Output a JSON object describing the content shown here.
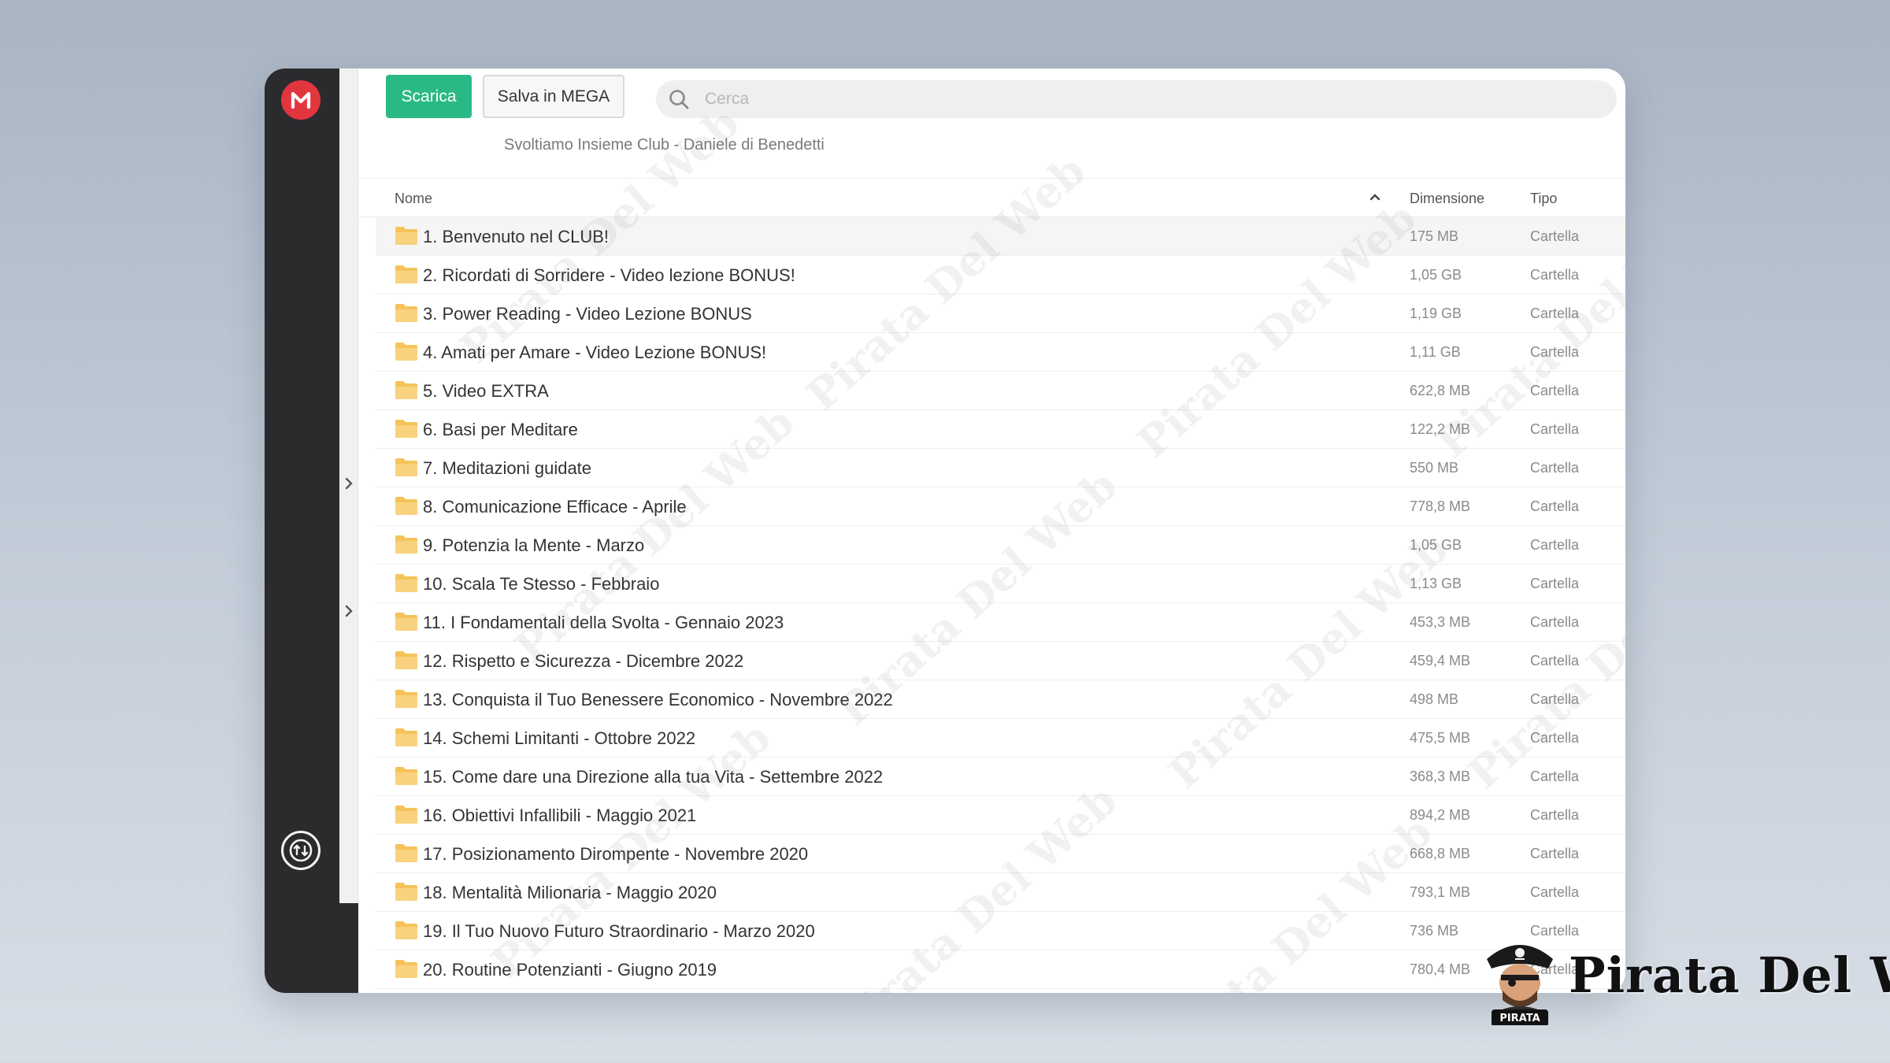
{
  "app": {
    "logo_letter": "M",
    "accent_color": "#e2363f",
    "primary_color": "#2ab985"
  },
  "toolbar": {
    "download_label": "Scarica",
    "save_label": "Salva in MEGA"
  },
  "search": {
    "placeholder": "Cerca",
    "value": ""
  },
  "breadcrumb": "Svoltiamo Insieme Club - Daniele di Benedetti",
  "table": {
    "columns": {
      "name": "Nome",
      "size": "Dimensione",
      "type": "Tipo"
    },
    "sort": "name-ascending",
    "rows": [
      {
        "name": "1. Benvenuto nel CLUB!",
        "size": "175 MB",
        "type": "Cartella"
      },
      {
        "name": "2. Ricordati di Sorridere - Video lezione BONUS!",
        "size": "1,05 GB",
        "type": "Cartella"
      },
      {
        "name": "3. Power Reading - Video Lezione BONUS",
        "size": "1,19 GB",
        "type": "Cartella"
      },
      {
        "name": "4. Amati per Amare - Video Lezione BONUS!",
        "size": "1,11 GB",
        "type": "Cartella"
      },
      {
        "name": "5. Video EXTRA",
        "size": "622,8 MB",
        "type": "Cartella"
      },
      {
        "name": "6. Basi per Meditare",
        "size": "122,2 MB",
        "type": "Cartella"
      },
      {
        "name": "7. Meditazioni guidate",
        "size": "550 MB",
        "type": "Cartella"
      },
      {
        "name": "8. Comunicazione Efficace - Aprile",
        "size": "778,8 MB",
        "type": "Cartella"
      },
      {
        "name": "9. Potenzia la Mente - Marzo",
        "size": "1,05 GB",
        "type": "Cartella"
      },
      {
        "name": "10. Scala Te Stesso - Febbraio",
        "size": "1,13 GB",
        "type": "Cartella"
      },
      {
        "name": "11. I Fondamentali della Svolta - Gennaio 2023",
        "size": "453,3 MB",
        "type": "Cartella"
      },
      {
        "name": "12. Rispetto e Sicurezza - Dicembre 2022",
        "size": "459,4 MB",
        "type": "Cartella"
      },
      {
        "name": "13. Conquista il Tuo Benessere Economico - Novembre 2022",
        "size": "498 MB",
        "type": "Cartella"
      },
      {
        "name": "14. Schemi Limitanti - Ottobre 2022",
        "size": "475,5 MB",
        "type": "Cartella"
      },
      {
        "name": "15. Come dare una Direzione alla tua Vita - Settembre 2022",
        "size": "368,3 MB",
        "type": "Cartella"
      },
      {
        "name": "16. Obiettivi Infallibili - Maggio 2021",
        "size": "894,2 MB",
        "type": "Cartella"
      },
      {
        "name": "17. Posizionamento Dirompente - Novembre 2020",
        "size": "668,8 MB",
        "type": "Cartella"
      },
      {
        "name": "18. Mentalità Milionaria - Maggio 2020",
        "size": "793,1 MB",
        "type": "Cartella"
      },
      {
        "name": "19. Il Tuo Nuovo Futuro Straordinario - Marzo 2020",
        "size": "736 MB",
        "type": "Cartella"
      },
      {
        "name": "20. Routine Potenzianti - Giugno 2019",
        "size": "780,4 MB",
        "type": "Cartella"
      }
    ]
  },
  "watermark": {
    "text": "Pirata Del Web",
    "brand_text": "Pirata Del Web",
    "mascot_label": "PIRATA"
  },
  "icons": {
    "logo": "mega-logo-icon",
    "transfer": "transfer-manager-icon",
    "search": "search-icon",
    "folder": "folder-icon",
    "sort": "chevron-up-icon",
    "expand": "chevron-right-icon"
  }
}
